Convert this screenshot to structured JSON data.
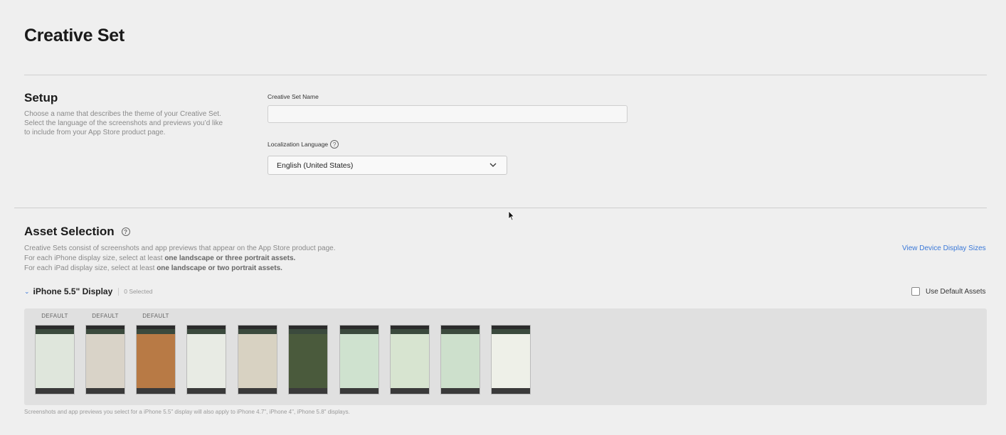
{
  "page": {
    "title": "Creative Set"
  },
  "setup": {
    "title": "Setup",
    "description_lines": [
      "Choose a name that describes the theme of your Creative Set.",
      "Select the language of the screenshots and previews you’d like",
      "to include from your App Store product page."
    ],
    "name_label": "Creative Set Name",
    "name_value": "",
    "language_label": "Localization Language",
    "language_value": "English (United States)"
  },
  "assets": {
    "title": "Asset Selection",
    "description_line1": "Creative Sets consist of screenshots and app previews that appear on the App Store product page.",
    "line2_prefix": "For each iPhone display size, select at least ",
    "line2_bold": "one landscape or three portrait assets.",
    "line3_prefix": "For each iPad display size, select at least ",
    "line3_bold": "one landscape or two portrait assets.",
    "view_sizes_link": "View Device Display Sizes",
    "display_title": "iPhone 5.5\" Display",
    "selected_count": "0 Selected",
    "use_default_label": "Use Default Assets",
    "default_tag": "DEFAULT",
    "footnote": "Screenshots and app previews you select for a iPhone 5.5\" display will also apply to iPhone 4.7\", iPhone 4\", iPhone 5.8\" displays.",
    "tiles": [
      {
        "name": "dashboard-screenshot",
        "default": true,
        "body": "#dfe6dc"
      },
      {
        "name": "story-screenshot",
        "default": true,
        "body": "#d9d3c8"
      },
      {
        "name": "journey-photo-screenshot",
        "default": true,
        "body": "#b87a45"
      },
      {
        "name": "challenges-list-screenshot",
        "default": false,
        "body": "#e8ebe4"
      },
      {
        "name": "community-screenshot",
        "default": false,
        "body": "#d8d2c2"
      },
      {
        "name": "achievement-trophy-screenshot",
        "default": false,
        "body": "#4a5a3c"
      },
      {
        "name": "map-distance-screenshot",
        "default": false,
        "body": "#cfe2cf"
      },
      {
        "name": "route-map-screenshot",
        "default": false,
        "body": "#d7e4d0"
      },
      {
        "name": "map-photos-screenshot",
        "default": false,
        "body": "#cde0cc"
      },
      {
        "name": "achievements-screenshot",
        "default": false,
        "body": "#eef0e8"
      }
    ]
  }
}
